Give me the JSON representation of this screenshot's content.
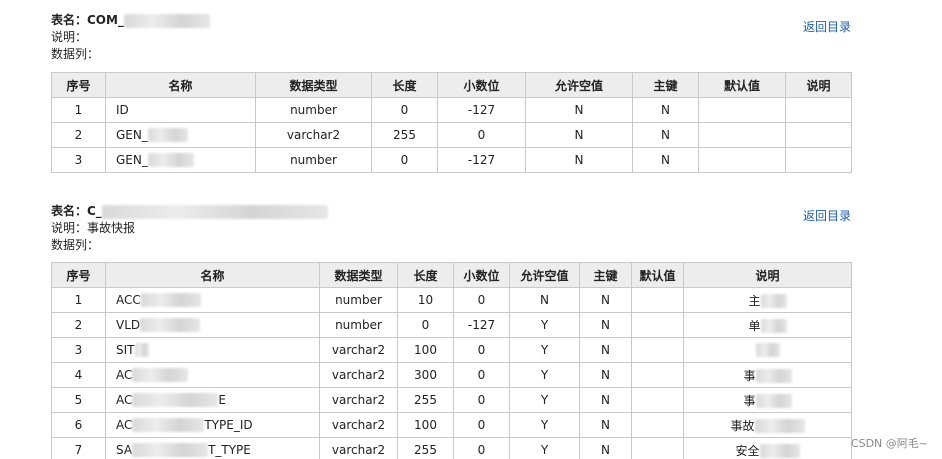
{
  "back_label": "返回目录",
  "watermark": "CSDN @阿毛~",
  "headers": [
    "序号",
    "名称",
    "数据类型",
    "长度",
    "小数位",
    "允许空值",
    "主键",
    "默认值",
    "说明"
  ],
  "table1": {
    "title": "表名：COM_",
    "desc": "说明：",
    "columns_label": "数据列：",
    "rows": [
      {
        "no": "1",
        "name": "ID",
        "type": "number",
        "len": "0",
        "dec": "-127",
        "nullable": "N",
        "pk": "N",
        "def": "",
        "note": ""
      },
      {
        "no": "2",
        "name": "GEN_",
        "type": "varchar2",
        "len": "255",
        "dec": "0",
        "nullable": "N",
        "pk": "N",
        "def": "",
        "note": ""
      },
      {
        "no": "3",
        "name": "GEN_",
        "type": "number",
        "len": "0",
        "dec": "-127",
        "nullable": "N",
        "pk": "N",
        "def": "",
        "note": ""
      }
    ]
  },
  "table2": {
    "title": "表名：C_",
    "desc": "说明：事故快报",
    "columns_label": "数据列：",
    "rows": [
      {
        "no": "1",
        "name": "ACC",
        "type": "number",
        "len": "10",
        "dec": "0",
        "nullable": "N",
        "pk": "N",
        "def": "",
        "note": "主"
      },
      {
        "no": "2",
        "name": "VLD",
        "type": "number",
        "len": "0",
        "dec": "-127",
        "nullable": "Y",
        "pk": "N",
        "def": "",
        "note": "单"
      },
      {
        "no": "3",
        "name": "SIT",
        "type": "varchar2",
        "len": "100",
        "dec": "0",
        "nullable": "Y",
        "pk": "N",
        "def": "",
        "note": ""
      },
      {
        "no": "4",
        "name": "AC",
        "type": "varchar2",
        "len": "300",
        "dec": "0",
        "nullable": "Y",
        "pk": "N",
        "def": "",
        "note": "事"
      },
      {
        "no": "5",
        "name": "AC",
        "name_tail": "E",
        "type": "varchar2",
        "len": "255",
        "dec": "0",
        "nullable": "Y",
        "pk": "N",
        "def": "",
        "note": "事"
      },
      {
        "no": "6",
        "name": "AC",
        "name_tail": "TYPE_ID",
        "type": "varchar2",
        "len": "100",
        "dec": "0",
        "nullable": "Y",
        "pk": "N",
        "def": "",
        "note": "事故"
      },
      {
        "no": "7",
        "name": "SA",
        "name_tail": "T_TYPE",
        "type": "varchar2",
        "len": "255",
        "dec": "0",
        "nullable": "Y",
        "pk": "N",
        "def": "",
        "note": "安全"
      }
    ]
  }
}
